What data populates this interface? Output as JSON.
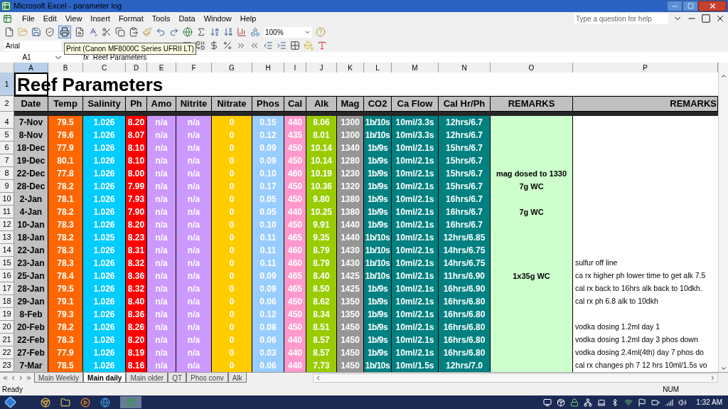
{
  "window": {
    "title": "Microsoft Excel - parameter log"
  },
  "menu": [
    "File",
    "Edit",
    "View",
    "Insert",
    "Format",
    "Tools",
    "Data",
    "Window",
    "Help"
  ],
  "help_box": {
    "placeholder": "Type a question for help"
  },
  "toolbar": {
    "zoom": "100%",
    "font": "Arial"
  },
  "tooltip": {
    "text": "Print (Canon MF8000C Series UFRII LT)"
  },
  "formula_bar": {
    "name_box": "A1",
    "fx": "fx",
    "value": "Reef Parameters"
  },
  "column_headers": [
    {
      "label": "A",
      "selected": true
    },
    {
      "label": "B",
      "selected": false
    },
    {
      "label": "C",
      "selected": false
    },
    {
      "label": "D",
      "selected": false
    },
    {
      "label": "E",
      "selected": false
    },
    {
      "label": "F",
      "selected": false
    },
    {
      "label": "G",
      "selected": false
    },
    {
      "label": "H",
      "selected": false
    },
    {
      "label": "I",
      "selected": false
    },
    {
      "label": "J",
      "selected": false
    },
    {
      "label": "K",
      "selected": false
    },
    {
      "label": "L",
      "selected": false
    },
    {
      "label": "M",
      "selected": false
    },
    {
      "label": "N",
      "selected": false
    },
    {
      "label": "O",
      "selected": false
    },
    {
      "label": "P",
      "selected": false
    }
  ],
  "title_row": {
    "row": "1",
    "selected": true,
    "title": "Reef Parameters"
  },
  "header_row": {
    "row": "2",
    "selected": false
  },
  "columns": [
    {
      "label": "Date",
      "kind": "date",
      "color": "#c0c0c0"
    },
    {
      "label": "Temp",
      "kind": "value",
      "color": "#ff6600"
    },
    {
      "label": "Salinity",
      "kind": "value",
      "color": "#00ccff"
    },
    {
      "label": "Ph",
      "kind": "value",
      "color": "#ff0000"
    },
    {
      "label": "Amo",
      "kind": "value",
      "color": "#cc99ff"
    },
    {
      "label": "Nitrite",
      "kind": "value",
      "color": "#cc99ff"
    },
    {
      "label": "Nitrate",
      "kind": "value",
      "color": "#ffcc00"
    },
    {
      "label": "Phos",
      "kind": "value",
      "color": "#99ccff"
    },
    {
      "label": "Cal",
      "kind": "value",
      "color": "#ff99cc"
    },
    {
      "label": "Alk",
      "kind": "value",
      "color": "#99cc00"
    },
    {
      "label": "Mag",
      "kind": "value",
      "color": "#969696"
    },
    {
      "label": "CO2",
      "kind": "value",
      "color": "#008080"
    },
    {
      "label": "Ca Flow",
      "kind": "value",
      "color": "#008080"
    },
    {
      "label": "Cal Hr/Ph",
      "kind": "value",
      "color": "#008080"
    },
    {
      "label": "REMARKS",
      "kind": "remark",
      "color": "#ccffcc"
    },
    {
      "label": "REMARKS",
      "kind": "note",
      "color": "#ffffff"
    }
  ],
  "rows": [
    {
      "row": "4",
      "selected": false,
      "cells": [
        "7-Nov",
        "79.5",
        "1.026",
        "8.20",
        "n/a",
        "n/a",
        "0",
        "0.15",
        "440",
        "8.06",
        "1300",
        "1b/10s",
        "10ml/3.3s",
        "12hrs/6.7"
      ]
    },
    {
      "row": "5",
      "selected": false,
      "cells": [
        "8-Nov",
        "79.6",
        "1.026",
        "8.07",
        "n/a",
        "n/a",
        "0",
        "0.12",
        "435",
        "8.01",
        "1300",
        "1b/10s",
        "10ml/3.3s",
        "12hrs/6.7"
      ]
    },
    {
      "row": "6",
      "selected": false,
      "cells": [
        "18-Dec",
        "77.9",
        "1.026",
        "8.10",
        "n/a",
        "n/a",
        "0",
        "0.09",
        "450",
        "10.14",
        "1340",
        "1b/9s",
        "10ml/2.1s",
        "15hrs/6.7"
      ]
    },
    {
      "row": "7",
      "selected": false,
      "cells": [
        "19-Dec",
        "80.1",
        "1.026",
        "8.10",
        "n/a",
        "n/a",
        "0",
        "0.09",
        "450",
        "10.14",
        "1280",
        "1b/9s",
        "10ml/2.1s",
        "15hrs/6.7"
      ]
    },
    {
      "row": "8",
      "selected": false,
      "cells": [
        "22-Dec",
        "77.8",
        "1.026",
        "8.00",
        "n/a",
        "n/a",
        "0",
        "0.10",
        "460",
        "10.19",
        "1230",
        "1b/9s",
        "10ml/2.1s",
        "15hrs/6.7"
      ],
      "remark": "mag dosed to 1330"
    },
    {
      "row": "9",
      "selected": false,
      "cells": [
        "28-Dec",
        "78.2",
        "1.026",
        "7.99",
        "n/a",
        "n/a",
        "0",
        "0.17",
        "450",
        "10.36",
        "1320",
        "1b/9s",
        "10ml/2.1s",
        "15hrs/6.7"
      ],
      "remark": "7g WC"
    },
    {
      "row": "10",
      "selected": false,
      "cells": [
        "2-Jan",
        "78.1",
        "1.026",
        "7.93",
        "n/a",
        "n/a",
        "0",
        "0.05",
        "450",
        "9.80",
        "1380",
        "1b/9s",
        "10ml/2.1s",
        "16hrs/6.7"
      ]
    },
    {
      "row": "11",
      "selected": false,
      "cells": [
        "4-Jan",
        "78.2",
        "1.026",
        "7.90",
        "n/a",
        "n/a",
        "0",
        "0.05",
        "440",
        "10.25",
        "1380",
        "1b/9s",
        "10ml/2.1s",
        "16hrs/6.7"
      ],
      "remark": "7g WC"
    },
    {
      "row": "12",
      "selected": false,
      "cells": [
        "10-Jan",
        "78.3",
        "1.026",
        "8.20",
        "n/a",
        "n/a",
        "0",
        "0.10",
        "450",
        "9.91",
        "1440",
        "1b/9s",
        "10ml/2.1s",
        "16hrs/6.7"
      ]
    },
    {
      "row": "13",
      "selected": false,
      "cells": [
        "18-Jan",
        "78.2",
        "1.025",
        "8.23",
        "n/a",
        "n/a",
        "0",
        "0.11",
        "465",
        "9.35",
        "1440",
        "1b/10s",
        "10ml/2.1s",
        "12hrs/6.85"
      ]
    },
    {
      "row": "14",
      "selected": false,
      "cells": [
        "22-Jan",
        "78.3",
        "1.026",
        "8.31",
        "n/a",
        "n/a",
        "0",
        "0.11",
        "460",
        "8.79",
        "1430",
        "1b/10s",
        "10ml/2.1s",
        "14hrs/6.75"
      ]
    },
    {
      "row": "15",
      "selected": false,
      "cells": [
        "23-Jan",
        "78.3",
        "1.026",
        "8.32",
        "n/a",
        "n/a",
        "0",
        "0.11",
        "460",
        "8.79",
        "1430",
        "1b/10s",
        "10ml/2.1s",
        "14hrs/6.75"
      ],
      "note": "sulfur off line"
    },
    {
      "row": "16",
      "selected": false,
      "cells": [
        "25-Jan",
        "78.4",
        "1.026",
        "8.36",
        "n/a",
        "n/a",
        "0",
        "0.09",
        "465",
        "8.40",
        "1425",
        "1b/10s",
        "10ml/2.1s",
        "11hrs/6.90"
      ],
      "remark": "1x35g WC",
      "note": "ca rx higher ph lower time to get alk 7.5"
    },
    {
      "row": "17",
      "selected": false,
      "cells": [
        "28-Jan",
        "79.5",
        "1.026",
        "8.32",
        "n/a",
        "n/a",
        "0",
        "0.09",
        "465",
        "8.50",
        "1425",
        "1b/9s",
        "10ml/2.1s",
        "16hrs/6.90"
      ],
      "note": "cal rx back to 16hrs alk back to 10dkh."
    },
    {
      "row": "18",
      "selected": false,
      "cells": [
        "29-Jan",
        "79.1",
        "1.026",
        "8.40",
        "n/a",
        "n/a",
        "0",
        "0.06",
        "450",
        "8.62",
        "1350",
        "1b/9s",
        "10ml/2.1s",
        "16hrs/6.80"
      ],
      "note": "cal rx ph 6.8 alk to 10dkh"
    },
    {
      "row": "19",
      "selected": false,
      "cells": [
        "8-Feb",
        "79.3",
        "1.026",
        "8.36",
        "n/a",
        "n/a",
        "0",
        "0.12",
        "450",
        "8.34",
        "1350",
        "1b/9s",
        "10ml/2.1s",
        "16hrs/6.80"
      ]
    },
    {
      "row": "20",
      "selected": false,
      "cells": [
        "20-Feb",
        "78.2",
        "1.026",
        "8.26",
        "n/a",
        "n/a",
        "0",
        "0.08",
        "450",
        "8.51",
        "1450",
        "1b/9s",
        "10ml/2.1s",
        "16hrs/6.80"
      ],
      "note": "vodka dosing 1.2ml day 1"
    },
    {
      "row": "21",
      "selected": false,
      "cells": [
        "22-Feb",
        "78.3",
        "1.026",
        "8.20",
        "n/a",
        "n/a",
        "0",
        "0.06",
        "440",
        "8.57",
        "1450",
        "1b/9s",
        "10ml/2.1s",
        "16hrs/6.80"
      ],
      "note": "vodka dosing 1.2ml day 3 phos down"
    },
    {
      "row": "22",
      "selected": false,
      "cells": [
        "27-Feb",
        "77.9",
        "1.026",
        "8.19",
        "n/a",
        "n/a",
        "0",
        "0.03",
        "440",
        "8.57",
        "1450",
        "1b/9s",
        "10ml/2.1s",
        "16hrs/6.80"
      ],
      "note": "vodka dosing 2.4ml(4th) day 7 phos do"
    },
    {
      "row": "23",
      "selected": false,
      "cells": [
        "7-Mar",
        "78.5",
        "1.026",
        "8.16",
        "n/a",
        "n/a",
        "0",
        "0.06",
        "440",
        "7.73",
        "1450",
        "1b/10s",
        "10ml/1.5s",
        "12hrs/7.0"
      ],
      "note": "cal rx changes ph 7 12 hrs 10ml/1.5s vo"
    }
  ],
  "sheet_tabs": [
    {
      "label": "Main Weekly",
      "selected": false
    },
    {
      "label": "Main daily",
      "selected": true
    },
    {
      "label": "Main older",
      "selected": false
    },
    {
      "label": "QT",
      "selected": false
    },
    {
      "label": "Phos conv",
      "selected": false
    },
    {
      "label": "Alk",
      "selected": false
    }
  ],
  "status_bar": {
    "text": "Ready",
    "indicator": "NUM"
  },
  "taskbar": {
    "clock": "1:32 AM"
  }
}
